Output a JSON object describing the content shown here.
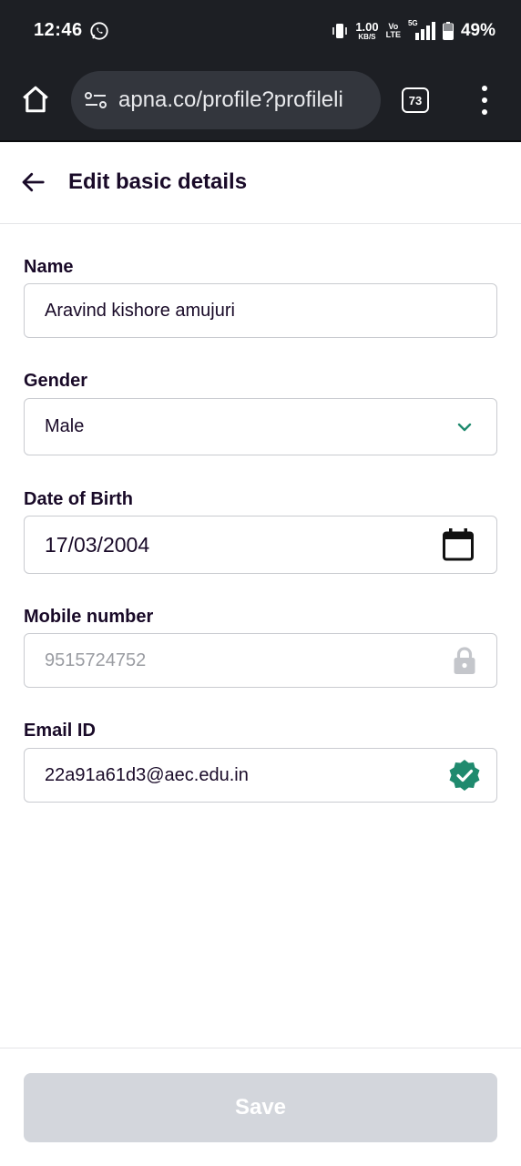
{
  "status_bar": {
    "time": "12:46",
    "net_speed_value": "1.00",
    "net_speed_unit": "KB/S",
    "volte_top": "Vo",
    "volte_bottom": "LTE",
    "network_tag": "5G",
    "battery": "49%"
  },
  "browser": {
    "url": "apna.co/profile?profileli",
    "tab_count": "73"
  },
  "header": {
    "title": "Edit basic details"
  },
  "form": {
    "name": {
      "label": "Name",
      "value": "Aravind kishore amujuri"
    },
    "gender": {
      "label": "Gender",
      "value": "Male"
    },
    "dob": {
      "label": "Date of Birth",
      "value": "17/03/2004"
    },
    "mobile": {
      "label": "Mobile number",
      "value": "9515724752"
    },
    "email": {
      "label": "Email ID",
      "value": "22a91a61d3@aec.edu.in"
    }
  },
  "footer": {
    "save_label": "Save"
  },
  "colors": {
    "accent_green": "#1f8a6e",
    "dark_bar": "#1d1f24",
    "disabled_button": "#d3d6dc"
  },
  "icons": {
    "status": [
      "whatsapp-icon",
      "vibrate-icon",
      "signal-icon",
      "battery-icon"
    ],
    "browser": [
      "home-icon",
      "site-settings-icon",
      "tabs-icon",
      "more-vert-icon"
    ],
    "form": [
      "chevron-down-icon",
      "calendar-icon",
      "lock-icon",
      "verified-badge-icon"
    ],
    "header": [
      "back-arrow-icon"
    ]
  }
}
